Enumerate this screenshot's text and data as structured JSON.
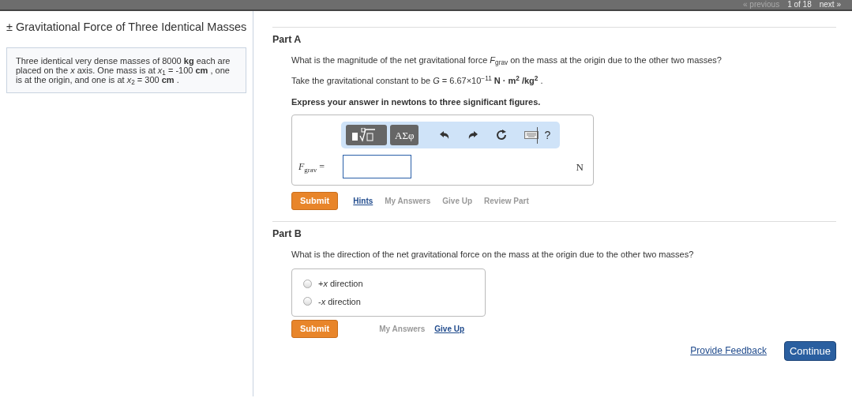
{
  "top_bar": {
    "links": [
      {
        "label": "« previous",
        "disabled": true
      },
      {
        "label": "1 of 18",
        "disabled": false
      },
      {
        "label": "next »",
        "disabled": false
      }
    ]
  },
  "sidebar": {
    "title": "± Gravitational Force of Three Identical Masses",
    "problem": "Three identical very dense masses of 8000 **kg** each are placed on the *x* axis. One mass is at *x*$_{1}$ = -100 **cm** , one is at the origin, and one is at *x*$_{2}$ = 300 **cm** ."
  },
  "parts": [
    {
      "kind": "numeric",
      "title": "Part A",
      "question": "What is the magnitude of the net gravitational force *F*$_{grav}$ on the mass at the origin due to the other two masses?",
      "note": "Take the gravitational constant to be *G* = 6.67×10$^{−11}$ **N · m$^{2}$ /kg$^{2}$** .",
      "instruction": "Express your answer in newtons to three significant figures.",
      "toolbar": {
        "symbols_button": "ΑΣφ",
        "help": "?"
      },
      "answer_label": "*F*$_{grav}$ =",
      "unit": "N",
      "submit": "Submit",
      "links": [
        {
          "label": "Hints",
          "disabled": false
        },
        {
          "label": "My Answers",
          "disabled": true
        },
        {
          "label": "Give Up",
          "disabled": true
        },
        {
          "label": "Review Part",
          "disabled": true
        }
      ]
    },
    {
      "kind": "choice",
      "title": "Part B",
      "question": "What is the direction of the net gravitational force on the mass at the origin due to the other two masses?",
      "options": [
        {
          "label": "+*x* direction",
          "selected": false
        },
        {
          "label": "-*x* direction",
          "selected": false
        }
      ],
      "submit": "Submit",
      "links": [
        {
          "label": "My Answers",
          "disabled": true
        },
        {
          "label": "Give Up",
          "disabled": false
        }
      ]
    }
  ],
  "footer": {
    "feedback_link": "Provide Feedback",
    "continue_button": "Continue"
  }
}
